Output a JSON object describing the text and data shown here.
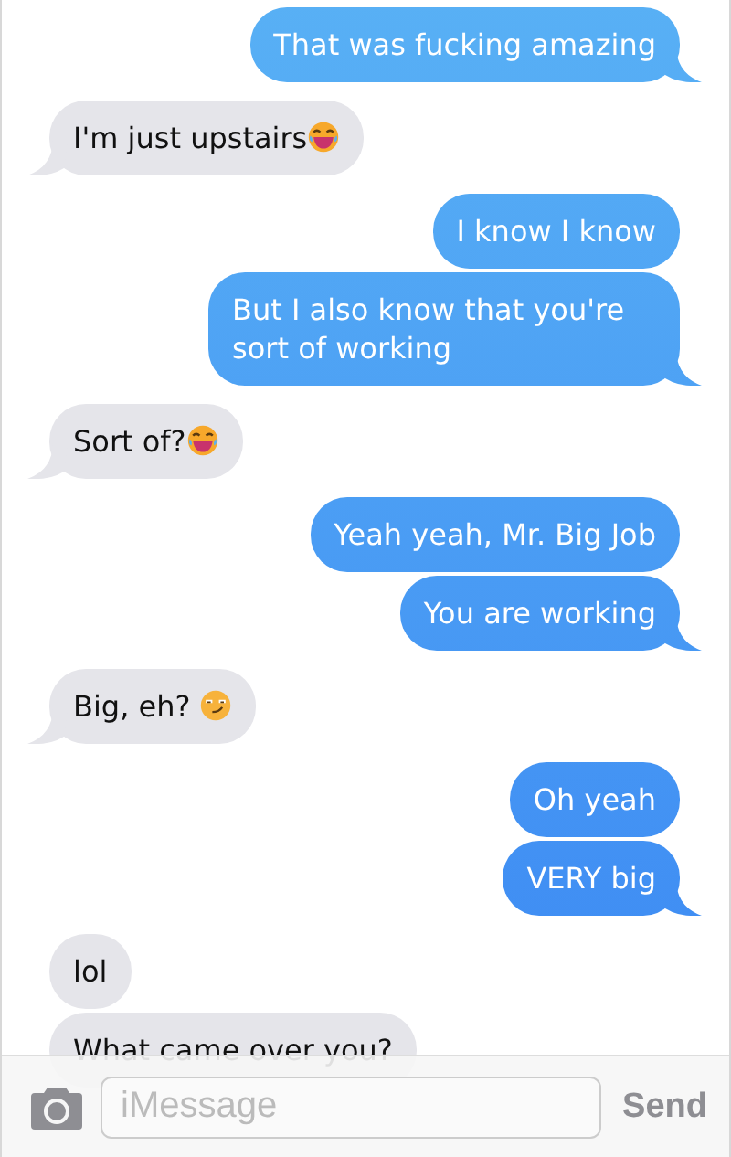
{
  "groups": [
    {
      "kind": "sent",
      "messages": [
        {
          "text": "That was fucking amazing",
          "kind": "plain"
        }
      ]
    },
    {
      "kind": "received",
      "messages": [
        {
          "text": "I'm just upstairs",
          "kind": "laugh"
        }
      ]
    },
    {
      "kind": "sent",
      "messages": [
        {
          "text": "I know I know",
          "kind": "plain"
        },
        {
          "text": "But I also know that you're sort of working",
          "kind": "plain"
        }
      ]
    },
    {
      "kind": "received",
      "messages": [
        {
          "text": "Sort of?",
          "kind": "laugh"
        }
      ]
    },
    {
      "kind": "sent",
      "messages": [
        {
          "text": "Yeah yeah, Mr. Big Job",
          "kind": "plain"
        },
        {
          "text": "You are working",
          "kind": "plain"
        }
      ]
    },
    {
      "kind": "received",
      "messages": [
        {
          "text": "Big, eh? ",
          "kind": "smirk"
        }
      ]
    },
    {
      "kind": "sent",
      "messages": [
        {
          "text": "Oh yeah",
          "kind": "plain"
        },
        {
          "text": "VERY big",
          "kind": "plain"
        }
      ]
    },
    {
      "kind": "received",
      "messages": [
        {
          "text": "lol",
          "kind": "plain"
        },
        {
          "text": "What came over you?",
          "kind": "plain"
        }
      ]
    }
  ],
  "composer": {
    "placeholder": "iMessage",
    "send": "Send"
  }
}
